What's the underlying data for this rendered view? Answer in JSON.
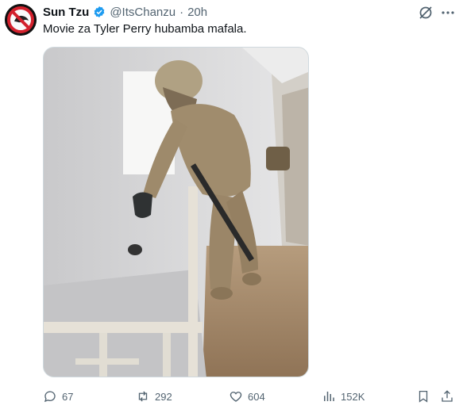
{
  "author": {
    "name": "Sun Tzu",
    "handle": "@ItsChanzu",
    "separator": "·",
    "time": "20h",
    "avatar_icon": "no-entry-logo-icon"
  },
  "tweet": {
    "text": "Movie za Tyler Perry hubamba mafala."
  },
  "media": {
    "description_icon": "photo-icon"
  },
  "actions": {
    "replies": "67",
    "reposts": "292",
    "likes": "604",
    "views": "152K"
  },
  "colors": {
    "muted": "#536471",
    "verified": "#1d9bf0",
    "text": "#0f1419"
  }
}
